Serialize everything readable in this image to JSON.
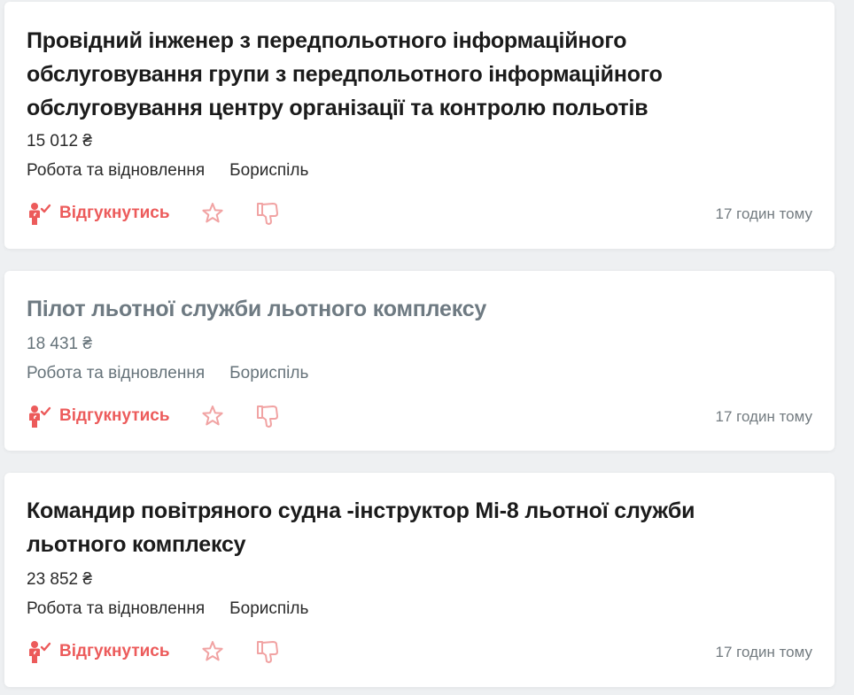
{
  "colors": {
    "accent": "#ec5b5b",
    "accent_light": "#f1a3a3",
    "title": "#1b1b1b",
    "title_visited": "#6e7a82",
    "background": "#eef0f2",
    "card": "#ffffff"
  },
  "icons": {
    "apply": "person-check-icon",
    "favorite": "star-outline-icon",
    "dislike": "thumbs-down-icon"
  },
  "vacancies": [
    {
      "title": "Провідний інженер з передпольотного інформаційного обслуговування групи з передпольотного інформаційного обслуговування центру організації та контролю польотів",
      "salary": "15 012 ₴",
      "category": "Робота та відновлення",
      "city": "Бориспіль",
      "apply_label": "Відгукнутись",
      "posted": "17 годин тому",
      "visited": false
    },
    {
      "title": "Пілот льотної служби льотного комплексу",
      "salary": "18 431 ₴",
      "category": "Робота та відновлення",
      "city": "Бориспіль",
      "apply_label": "Відгукнутись",
      "posted": "17 годин тому",
      "visited": true
    },
    {
      "title": "Командир повітряного судна -інструктор Мі-8 льотної служби льотного комплексу",
      "salary": "23 852 ₴",
      "category": "Робота та відновлення",
      "city": "Бориспіль",
      "apply_label": "Відгукнутись",
      "posted": "17 годин тому",
      "visited": false
    }
  ]
}
